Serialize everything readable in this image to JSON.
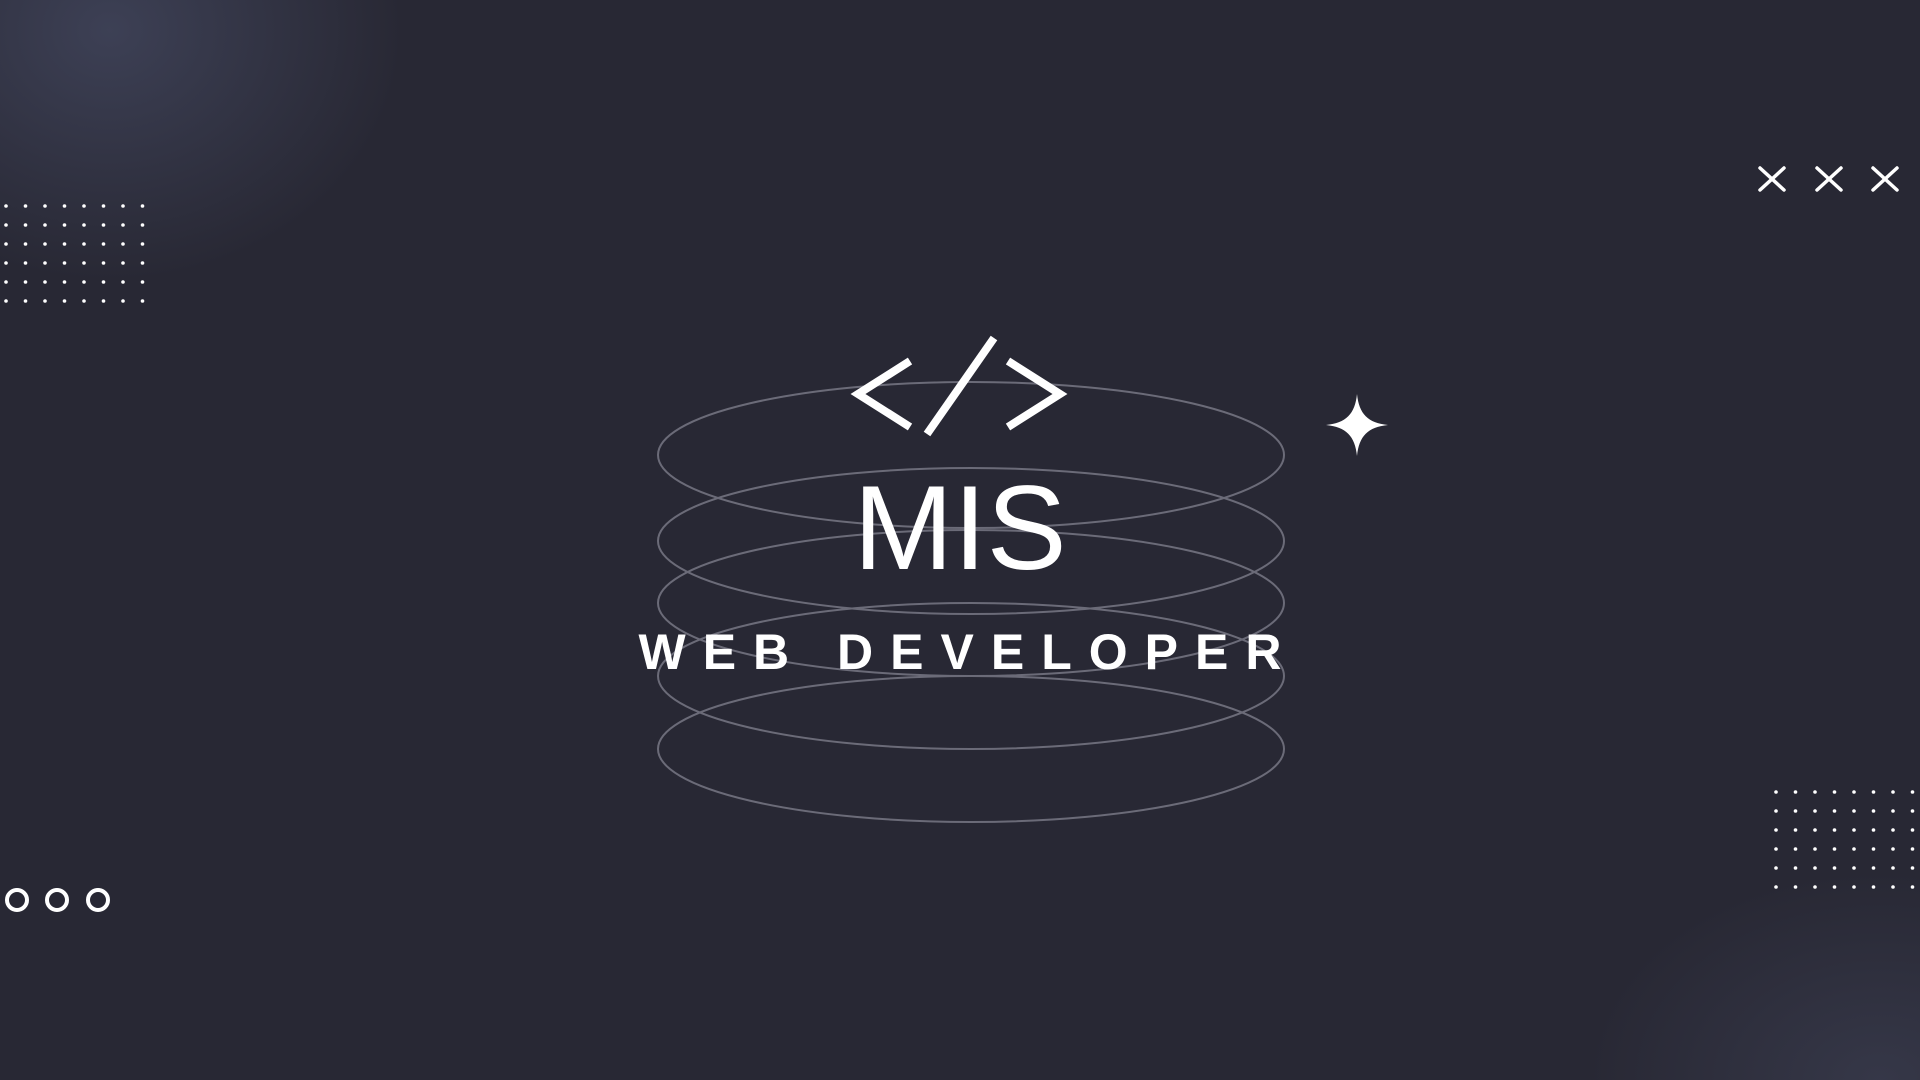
{
  "brand": {
    "logo_icon": "code-brackets-icon",
    "name": "MIS",
    "tagline": "WEB DEVELOPER"
  },
  "decorations": {
    "sparkle_icon": "four-point-star-icon",
    "cross_icons": [
      "close-icon",
      "close-icon",
      "close-icon"
    ],
    "circle_icons": [
      "circle-icon",
      "circle-icon",
      "circle-icon"
    ],
    "dot_grids": [
      "dot-grid-icon",
      "dot-grid-icon"
    ]
  },
  "colors": {
    "background": "#282834",
    "foreground": "#ffffff",
    "ring_stroke": "#6b6b78"
  }
}
